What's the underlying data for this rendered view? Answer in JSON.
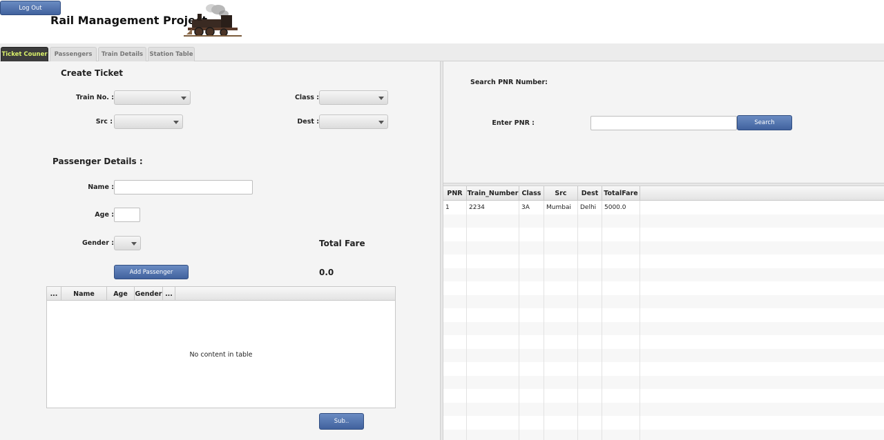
{
  "header": {
    "logout_label": "Log Out",
    "app_title": "Rail Management Project"
  },
  "tabs": [
    {
      "label": "Ticket Couner",
      "active": true
    },
    {
      "label": "Passengers",
      "active": false
    },
    {
      "label": "Train Details",
      "active": false
    },
    {
      "label": "Station Table",
      "active": false
    }
  ],
  "create_ticket": {
    "heading": "Create Ticket",
    "train_no_label": "Train No. :",
    "class_label": "Class :",
    "src_label": "Src :",
    "dest_label": "Dest :"
  },
  "passenger_details": {
    "heading": "Passenger Details :",
    "name_label": "Name :",
    "age_label": "Age :",
    "gender_label": "Gender :",
    "add_button": "Add Passenger",
    "total_fare_label": "Total Fare",
    "total_fare_value": "0.0",
    "submit_button": "Sub..",
    "table": {
      "columns": [
        "...",
        "Name",
        "Age",
        "Gender",
        "..."
      ],
      "empty_message": "No content in table"
    }
  },
  "search": {
    "heading": "Search PNR Number:",
    "enter_label": "Enter PNR :",
    "button": "Search"
  },
  "pnr_table": {
    "columns": [
      "PNR",
      "Train_Number",
      "Class",
      "Src",
      "Dest",
      "TotalFare"
    ],
    "rows": [
      [
        "1",
        "2234",
        "3A",
        "Mumbai",
        "Delhi",
        "5000.0"
      ]
    ]
  },
  "colors": {
    "button_blue": "#4f70ab",
    "active_tab_bg": "#3c3c3c",
    "active_tab_text": "#d9f06a"
  }
}
